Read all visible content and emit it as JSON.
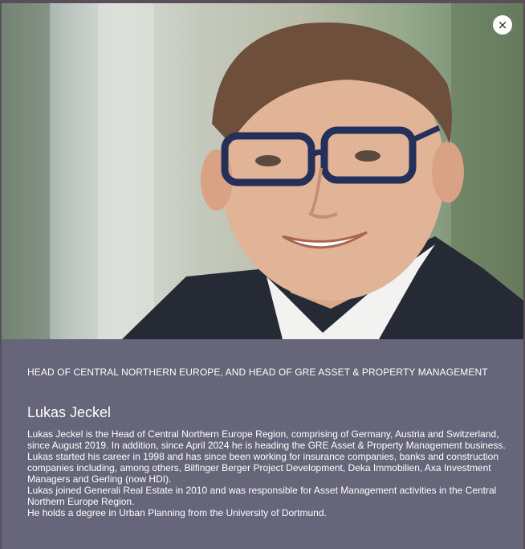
{
  "modal": {
    "close_label": "×",
    "photo_alt": "Portrait of Lukas Jeckel",
    "role": "HEAD OF CENTRAL NORTHERN EUROPE, AND HEAD OF GRE ASSET & PROPERTY MANAGEMENT",
    "name": "Lukas Jeckel",
    "bio": [
      "Lukas Jeckel is the Head of Central Northern Europe Region, comprising of Germany, Austria and Switzerland, since August 2019. In addition, since April 2024 he is heading the GRE Asset & Property Management business.",
      "Lukas started his career in 1998 and has since been working for insurance companies, banks and construction companies including, among others, Bilfinger Berger Project Development, Deka Immobilien, Axa Investment Managers and Gerling (now HDI).",
      "Lukas joined Generali Real Estate in 2010 and was responsible for Asset Management activities in the Central Northern Europe Region.",
      "He holds a degree in Urban Planning from the University of Dortmund."
    ]
  },
  "colors": {
    "panel": "#66657a",
    "text": "#ffffff",
    "close_bg": "#ffffff"
  }
}
